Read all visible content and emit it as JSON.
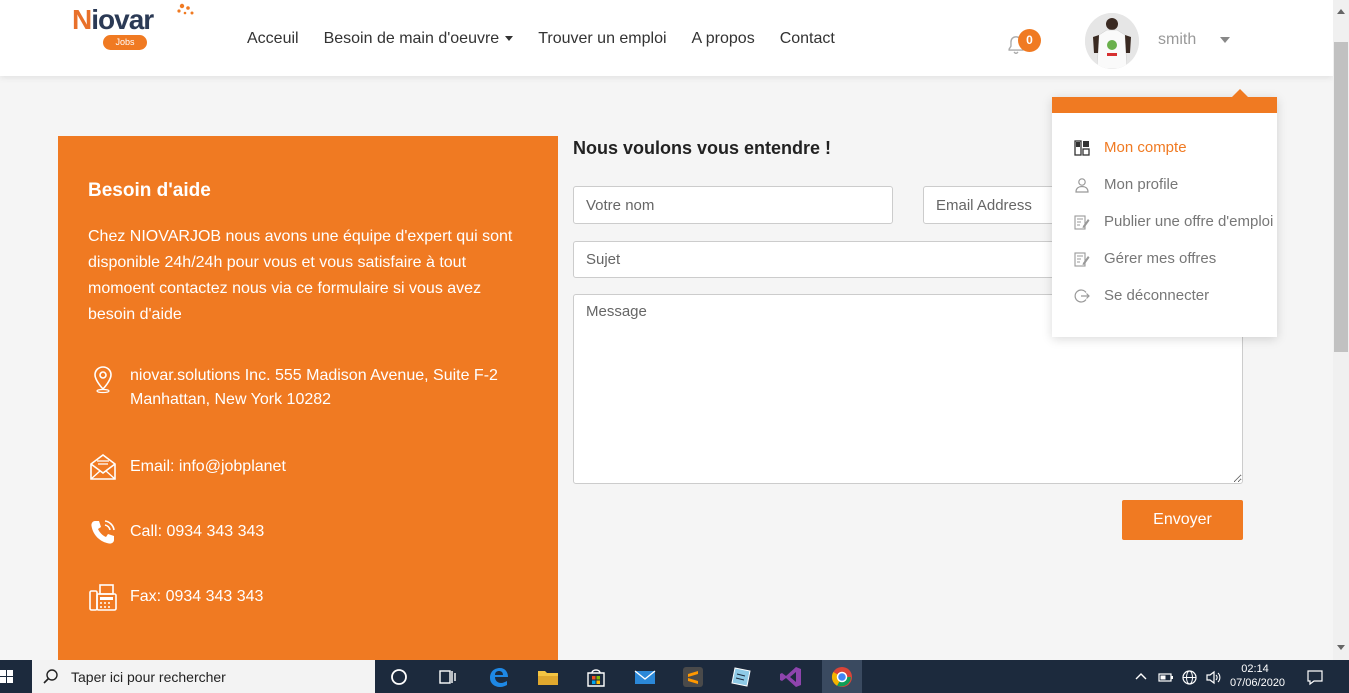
{
  "header": {
    "logo_text_n": "N",
    "logo_text_rest": "iovar",
    "logo_badge": "Jobs",
    "nav": [
      {
        "label": "Acceuil"
      },
      {
        "label": "Besoin de main d'oeuvre",
        "has_caret": true
      },
      {
        "label": "Trouver un emploi"
      },
      {
        "label": "A propos"
      },
      {
        "label": "Contact"
      }
    ],
    "notification_count": "0",
    "username": "smith"
  },
  "help": {
    "title": "Besoin d'aide",
    "text": "Chez NIOVARJOB nous avons une équipe d'expert qui sont disponible 24h/24h pour vous et vous satisfaire à tout momoent contactez nous via ce formulaire si vous avez besoin d'aide",
    "address": "niovar.solutions Inc. 555 Madison Avenue, Suite F-2 Manhattan, New York 10282",
    "email": "Email: info@jobplanet",
    "call": "Call: 0934 343 343",
    "fax": "Fax: 0934 343 343"
  },
  "form": {
    "title": "Nous voulons vous entendre !",
    "name_placeholder": "Votre nom",
    "email_placeholder": "Email Address",
    "subject_placeholder": "Sujet",
    "message_placeholder": "Message",
    "submit_label": "Envoyer"
  },
  "user_menu": {
    "items": [
      {
        "label": "Mon compte",
        "icon": "dashboard-icon",
        "active": true
      },
      {
        "label": "Mon profile",
        "icon": "user-icon"
      },
      {
        "label": "Publier une offre d'emploi",
        "icon": "edit-icon"
      },
      {
        "label": "Gérer mes offres",
        "icon": "edit-icon"
      },
      {
        "label": "Se déconnecter",
        "icon": "logout-icon"
      }
    ]
  },
  "taskbar": {
    "search_placeholder": "Taper ici pour rechercher",
    "time": "02:14",
    "date": "07/06/2020"
  },
  "colors": {
    "accent": "#f07a22",
    "taskbar": "#1c2a3d"
  }
}
